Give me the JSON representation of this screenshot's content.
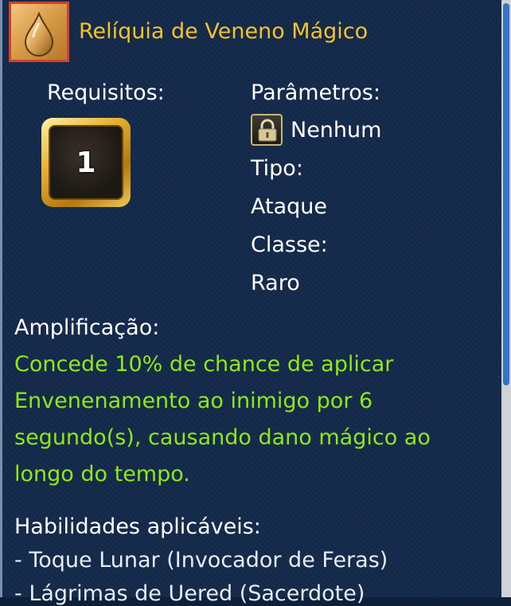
{
  "item": {
    "name": "Relíquia de Veneno Mágico",
    "icon": "poison-drop-icon"
  },
  "requirements": {
    "label": "Requisitos:",
    "level": "1"
  },
  "parameters": {
    "label": "Parâmetros:",
    "value": "Nenhum",
    "lock_icon": "lock-icon",
    "type_label": "Tipo:",
    "type_value": "Ataque",
    "class_label": "Classe:",
    "class_value": "Raro"
  },
  "amplification": {
    "label": "Amplificação:",
    "lines": [
      "Concede 10% de chance de aplicar",
      "Envenenamento ao inimigo por 6",
      "segundo(s), causando dano mágico ao",
      "longo do tempo."
    ]
  },
  "skills": {
    "label": "Habilidades aplicáveis:",
    "items": [
      " - Toque Lunar (Invocador de Feras)",
      " - Lágrimas de Uered (Sacerdote)"
    ]
  },
  "colors": {
    "title": "#f5c229",
    "effect_text": "#8fe817",
    "panel": "#142a4b",
    "scroll_thumb": "#3a73c2"
  }
}
